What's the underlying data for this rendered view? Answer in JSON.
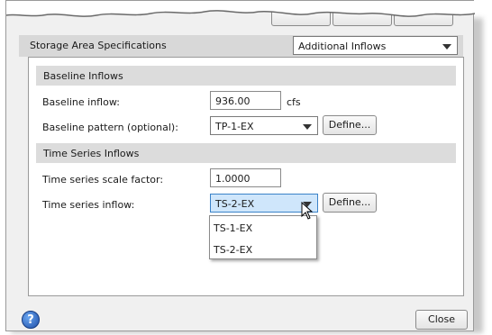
{
  "dialog": {
    "section_title": "Storage Area Specifications",
    "view_combo": {
      "value": "Additional Inflows"
    }
  },
  "baseline_group": {
    "title": "Baseline Inflows",
    "inflow_label": "Baseline inflow:",
    "inflow_value": "936.00",
    "inflow_unit": "cfs",
    "pattern_label": "Baseline pattern (optional):",
    "pattern_value": "TP-1-EX",
    "define_label": "Define..."
  },
  "timeseries_group": {
    "title": "Time Series Inflows",
    "scale_label": "Time series scale factor:",
    "scale_value": "1.0000",
    "inflow_label": "Time series inflow:",
    "inflow_value": "TS-2-EX",
    "define_label": "Define...",
    "options": [
      "TS-1-EX",
      "TS-2-EX"
    ]
  },
  "footer": {
    "close_label": "Close",
    "help_glyph": "?"
  },
  "icons": [
    "help-icon",
    "chevron-down-icon",
    "mouse-cursor-icon"
  ]
}
